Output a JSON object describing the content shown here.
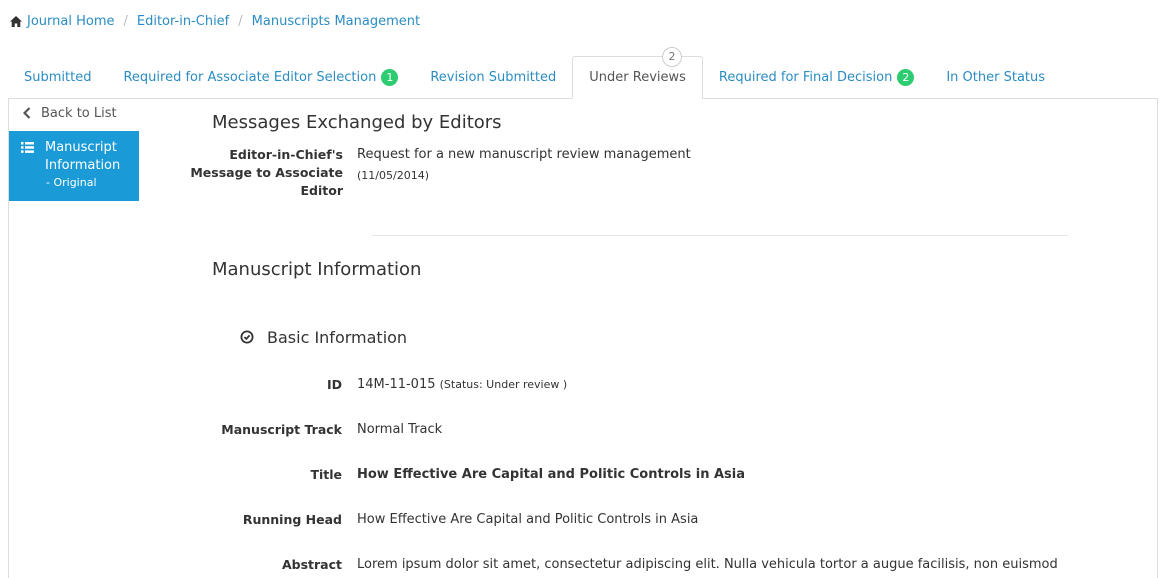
{
  "breadcrumb": {
    "items": [
      "Journal Home",
      "Editor-in-Chief",
      "Manuscripts Management"
    ],
    "separator": "/"
  },
  "tabs": [
    {
      "label": "Submitted"
    },
    {
      "label": "Required for Associate Editor Selection",
      "badge": "1"
    },
    {
      "label": "Revision Submitted"
    },
    {
      "label": "Under Reviews",
      "active": true,
      "badge": "2"
    },
    {
      "label": "Required for Final Decision",
      "badge": "2"
    },
    {
      "label": "In Other Status"
    }
  ],
  "sidebar": {
    "back_label": "Back to List",
    "item_title": "Manuscript Information",
    "item_sub": "- Original"
  },
  "messages": {
    "title": "Messages Exchanged by Editors",
    "label": "Editor-in-Chief's Message to Associate Editor",
    "text": "Request for a new manuscript review management",
    "date": "(11/05/2014)"
  },
  "manuscript": {
    "title": "Manuscript Information",
    "basic_heading": "Basic Information",
    "fields": {
      "id_label": "ID",
      "id_value": "14M-11-015",
      "id_status": "(Status: Under review )",
      "track_label": "Manuscript Track",
      "track_value": "Normal Track",
      "title_label": "Title",
      "title_value": "How Effective Are Capital and Politic Controls in Asia",
      "running_label": "Running Head",
      "running_value": "How Effective Are Capital and Politic Controls in Asia",
      "abstract_label": "Abstract",
      "abstract_value": "Lorem ipsum dolor sit amet, consectetur adipiscing elit. Nulla vehicula tortor a augue facilisis, non euismod"
    }
  },
  "colors": {
    "link": "#2b8cc4",
    "badge": "#2ecc71",
    "sidebar_active": "#1a9bd7"
  }
}
